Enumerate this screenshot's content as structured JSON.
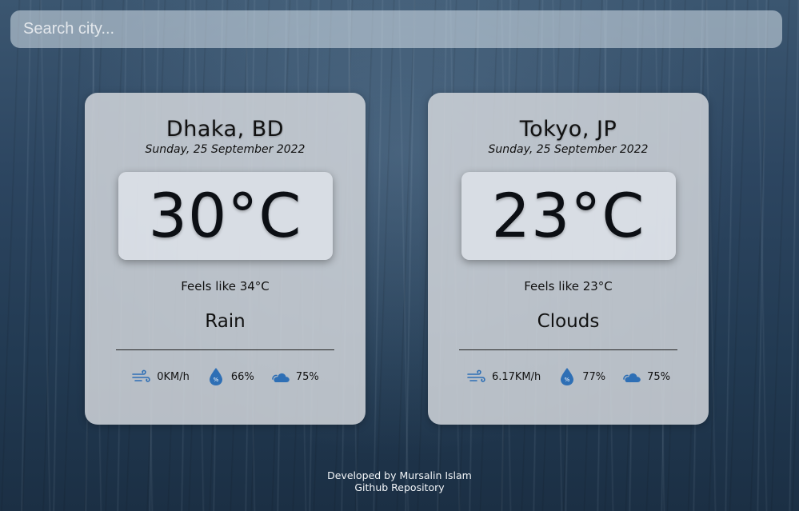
{
  "search": {
    "placeholder": "Search city..."
  },
  "colors": {
    "icon_blue": "#2e6fb5",
    "card_bg": "#cdd2d7"
  },
  "cards": [
    {
      "city": "Dhaka, BD",
      "date": "Sunday, 25 September 2022",
      "temperature": "30°C",
      "feels_like": "Feels like 34°C",
      "condition": "Rain",
      "wind": {
        "icon": "wind-icon",
        "value": "0KM/h"
      },
      "humidity": {
        "icon": "humidity-drop-icon",
        "value": "66%"
      },
      "clouds": {
        "icon": "cloud-icon",
        "value": "75%"
      }
    },
    {
      "city": "Tokyo, JP",
      "date": "Sunday, 25 September 2022",
      "temperature": "23°C",
      "feels_like": "Feels like 23°C",
      "condition": "Clouds",
      "wind": {
        "icon": "wind-icon",
        "value": "6.17KM/h"
      },
      "humidity": {
        "icon": "humidity-drop-icon",
        "value": "77%"
      },
      "clouds": {
        "icon": "cloud-icon",
        "value": "75%"
      }
    }
  ],
  "footer": {
    "credit": "Developed by Mursalin Islam",
    "repo_link": "Github Repository"
  }
}
